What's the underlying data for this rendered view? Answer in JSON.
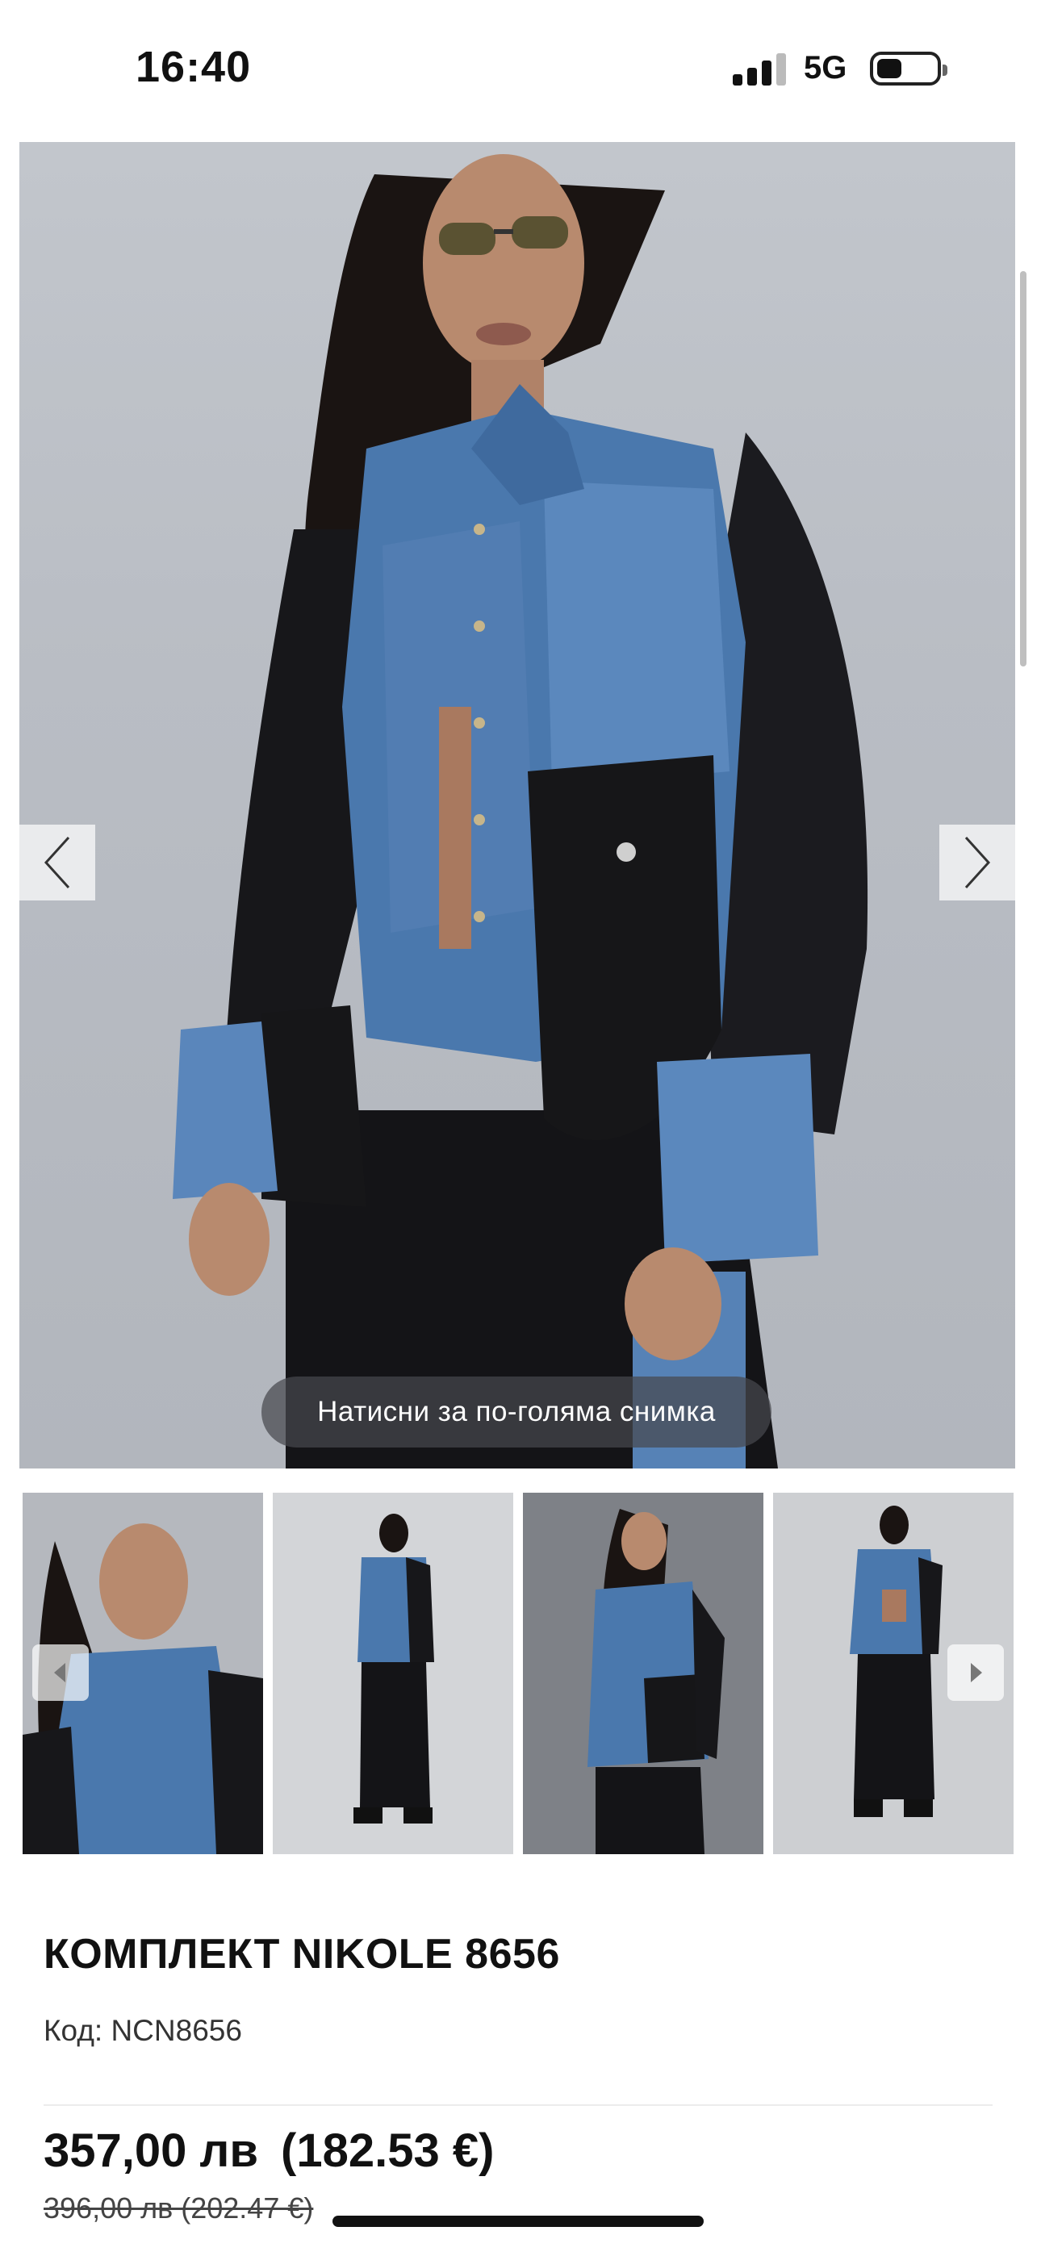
{
  "status_bar": {
    "time": "16:40",
    "network": "5G"
  },
  "gallery": {
    "zoom_hint": "Натисни за по-голяма снимка",
    "thumbnails": [
      "thumb-1",
      "thumb-2",
      "thumb-3",
      "thumb-4"
    ]
  },
  "product": {
    "title": "КОМПЛЕКТ NIKOLE 8656",
    "code": "Код: NCN8656",
    "price_bgn": "357,00 лв",
    "price_eur": "(182.53 €)",
    "old_price": "396,00 лв (202.47 €)"
  },
  "colors": {
    "background": "#ffffff",
    "text": "#111111",
    "denim": "#4a78ad",
    "black_fabric": "#17171a"
  },
  "icons": {
    "prev": "chevron-left-icon",
    "next": "chevron-right-icon"
  }
}
